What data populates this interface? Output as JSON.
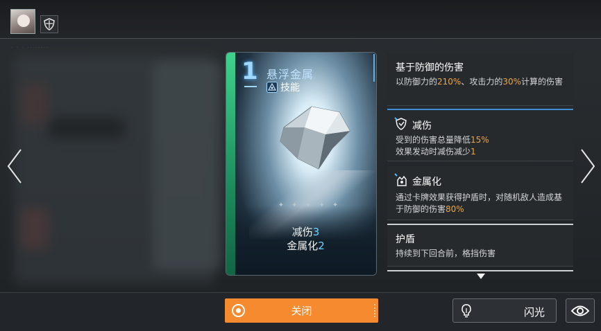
{
  "card": {
    "cost": "1",
    "title": "悬浮金属",
    "type": "技能",
    "stats": [
      {
        "label": "减伤",
        "value": "3"
      },
      {
        "label": "金属化",
        "value": "2"
      }
    ]
  },
  "descriptions": [
    {
      "title": "基于防御的伤害",
      "body": [
        {
          "text": "以防御力的"
        },
        {
          "text": "210%",
          "hl": true
        },
        {
          "text": "、攻击力的"
        },
        {
          "text": "30%",
          "hl": true
        },
        {
          "text": "计算的伤害"
        }
      ]
    },
    {
      "title": "减伤",
      "icon": "damage-reduction-icon",
      "lines": [
        [
          {
            "text": "受到的伤害总量降低"
          },
          {
            "text": "15%",
            "hl": true
          }
        ],
        [
          {
            "text": "效果发动时减伤减少"
          },
          {
            "text": "1",
            "hl": true
          }
        ]
      ]
    },
    {
      "title": "金属化",
      "icon": "metallize-icon",
      "body": [
        {
          "text": "通过卡牌效果获得护盾时，对随机敌人造成基于防御的伤害"
        },
        {
          "text": "80%",
          "hl": true
        }
      ]
    },
    {
      "title": "护盾",
      "body": [
        {
          "text": "持续到下回合前，格挡伤害"
        }
      ]
    }
  ],
  "buttons": {
    "close": "关闭",
    "flash": "闪光"
  },
  "colors": {
    "accent_orange": "#f58a2e",
    "highlight": "#f0a640",
    "card_stripe": "#3fd28e",
    "stat_number": "#6fd3ff"
  }
}
